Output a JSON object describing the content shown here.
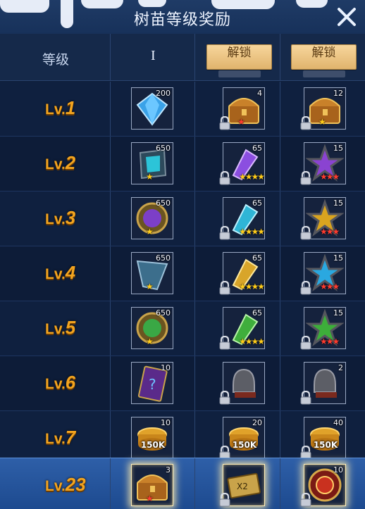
{
  "title": "树苗等级奖励",
  "header": {
    "level_label": "等级",
    "tier_label": "I",
    "unlock_label_1": "解锁",
    "unlock_label_2": "解锁"
  },
  "rows": [
    {
      "lv_prefix": "Lv.",
      "lv_num": "1",
      "cells": [
        {
          "icon": "blue-diamond-icon",
          "qty": "200",
          "stars": "",
          "star_color": "",
          "locked": false,
          "caption": ""
        },
        {
          "icon": "treasure-chest-icon",
          "qty": "4",
          "stars": "★",
          "star_color": "red",
          "locked": true,
          "caption": ""
        },
        {
          "icon": "treasure-chest-icon",
          "qty": "12",
          "stars": "★",
          "star_color": "gold",
          "locked": true,
          "caption": ""
        }
      ]
    },
    {
      "lv_prefix": "Lv.",
      "lv_num": "2",
      "cells": [
        {
          "icon": "cyan-rune-stone-icon",
          "qty": "650",
          "stars": "★",
          "star_color": "gold",
          "locked": false,
          "caption": ""
        },
        {
          "icon": "purple-crystal-icon",
          "qty": "65",
          "stars": "★★★★",
          "star_color": "gold",
          "locked": true,
          "caption": ""
        },
        {
          "icon": "purple-star-shuriken-icon",
          "qty": "15",
          "stars": "★★★",
          "star_color": "red",
          "locked": true,
          "caption": ""
        }
      ]
    },
    {
      "lv_prefix": "Lv.",
      "lv_num": "3",
      "cells": [
        {
          "icon": "purple-rune-stone-icon",
          "qty": "650",
          "stars": "★",
          "star_color": "gold",
          "locked": false,
          "caption": ""
        },
        {
          "icon": "cyan-crystal-icon",
          "qty": "65",
          "stars": "★★★★",
          "star_color": "gold",
          "locked": true,
          "caption": ""
        },
        {
          "icon": "gold-star-shuriken-icon",
          "qty": "15",
          "stars": "★★★",
          "star_color": "red",
          "locked": true,
          "caption": ""
        }
      ]
    },
    {
      "lv_prefix": "Lv.",
      "lv_num": "4",
      "cells": [
        {
          "icon": "blue-shard-icon",
          "qty": "650",
          "stars": "★",
          "star_color": "gold",
          "locked": false,
          "caption": ""
        },
        {
          "icon": "gold-crystal-icon",
          "qty": "65",
          "stars": "★★★★",
          "star_color": "gold",
          "locked": true,
          "caption": ""
        },
        {
          "icon": "blue-star-shuriken-icon",
          "qty": "15",
          "stars": "★★★",
          "star_color": "red",
          "locked": true,
          "caption": ""
        }
      ]
    },
    {
      "lv_prefix": "Lv.",
      "lv_num": "5",
      "cells": [
        {
          "icon": "green-rune-stone-icon",
          "qty": "650",
          "stars": "★",
          "star_color": "gold",
          "locked": false,
          "caption": ""
        },
        {
          "icon": "green-crystal-icon",
          "qty": "65",
          "stars": "★★★★",
          "star_color": "gold",
          "locked": true,
          "caption": ""
        },
        {
          "icon": "green-star-shuriken-icon",
          "qty": "15",
          "stars": "★★★",
          "star_color": "red",
          "locked": true,
          "caption": ""
        }
      ]
    },
    {
      "lv_prefix": "Lv.",
      "lv_num": "6",
      "cells": [
        {
          "icon": "mystery-card-icon",
          "qty": "10",
          "stars": "",
          "star_color": "",
          "locked": false,
          "caption": ""
        },
        {
          "icon": "warrior-helmet-icon",
          "qty": "",
          "stars": "",
          "star_color": "",
          "locked": true,
          "caption": ""
        },
        {
          "icon": "warrior-helmet-icon",
          "qty": "2",
          "stars": "",
          "star_color": "",
          "locked": true,
          "caption": ""
        }
      ]
    },
    {
      "lv_prefix": "Lv.",
      "lv_num": "7",
      "cells": [
        {
          "icon": "gold-coins-icon",
          "qty": "10",
          "stars": "",
          "star_color": "",
          "locked": false,
          "caption": "150K"
        },
        {
          "icon": "gold-coins-icon",
          "qty": "20",
          "stars": "",
          "star_color": "",
          "locked": true,
          "caption": "150K"
        },
        {
          "icon": "gold-coins-icon",
          "qty": "40",
          "stars": "",
          "star_color": "",
          "locked": true,
          "caption": "150K"
        }
      ]
    },
    {
      "lv_prefix": "Lv.",
      "lv_num": "23",
      "cells": [
        {
          "icon": "treasure-chest-icon",
          "qty": "3",
          "stars": "★",
          "star_color": "red",
          "locked": false,
          "caption": ""
        },
        {
          "icon": "x2-scroll-icon",
          "qty": "",
          "stars": "",
          "star_color": "",
          "locked": true,
          "caption": ""
        },
        {
          "icon": "red-emblem-icon",
          "qty": "10",
          "stars": "",
          "star_color": "",
          "locked": true,
          "caption": ""
        }
      ]
    }
  ],
  "colors": {
    "accent": "#f3a41f",
    "panel": "#0f203f",
    "current_row": "#2e5fa8"
  }
}
